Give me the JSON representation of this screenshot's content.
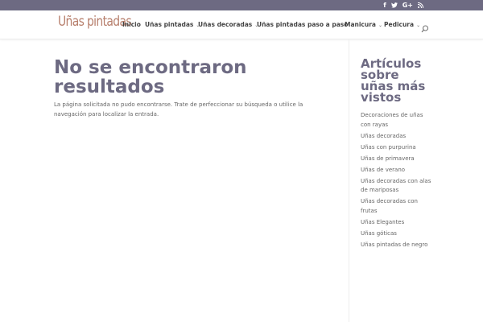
{
  "site": {
    "logo_text": "Uñas pintadas"
  },
  "social": {
    "facebook": "f",
    "twitter": "twitter-icon",
    "googleplus": "G+",
    "rss": "rss-icon"
  },
  "nav": {
    "items": [
      {
        "label": "Inicio",
        "has_dropdown": false
      },
      {
        "label": "Uñas pintadas",
        "has_dropdown": true
      },
      {
        "label": "Uñas decoradas",
        "has_dropdown": true
      },
      {
        "label": "Uñas pintadas paso a paso",
        "has_dropdown": true
      },
      {
        "label": "Manicura",
        "has_dropdown": true
      },
      {
        "label": "Pedicura",
        "has_dropdown": true
      }
    ],
    "dropdown_glyph": "⌄"
  },
  "main": {
    "title": "No se encontraron resultados",
    "description": "La página solicitada no pudo encontrarse. Trate de perfeccionar su búsqueda o utilice la navegación para localizar la entrada."
  },
  "sidebar": {
    "title": "Artículos sobre uñas más vistos",
    "links": [
      "Decoraciones de uñas con rayas",
      "Uñas decoradas",
      "Uñas con purpurina",
      "Uñas de primavera",
      "Uñas de verano",
      "Uñas decoradas con alas de mariposas",
      "Uñas decoradas con frutas",
      "Uñas Elegantes",
      "Uñas góticas",
      "Uñas pintadas de negro"
    ]
  },
  "colors": {
    "topbar": "#6d6a82",
    "heading": "#6d6a82",
    "logo": "#b77f6c"
  }
}
